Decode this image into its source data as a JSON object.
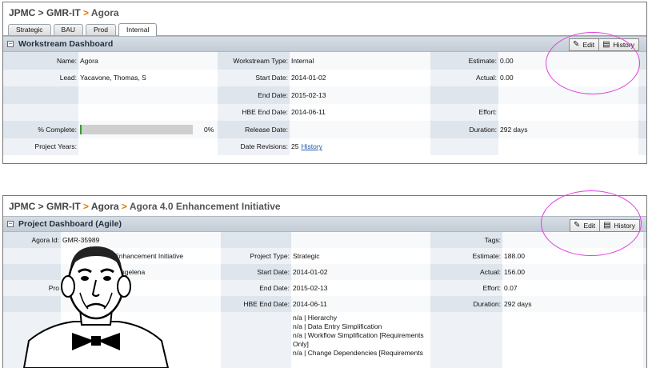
{
  "panel1": {
    "breadcrumb": {
      "a": "JPMC",
      "sep1": " > ",
      "b": "GMR-IT",
      "sep2": " > ",
      "c": "Agora"
    },
    "tabs": [
      "Strategic",
      "BAU",
      "Prod",
      "Internal"
    ],
    "header_title": "Workstream Dashboard",
    "edit_label": "Edit",
    "history_label": "History",
    "fields": {
      "name_label": "Name:",
      "name": "Agora",
      "lead_label": "Lead:",
      "lead": "Yacavone, Thomas, S",
      "pct_label": "% Complete:",
      "pct": "0%",
      "years_label": "Project Years:",
      "ws_type_label": "Workstream Type:",
      "ws_type": "Internal",
      "start_label": "Start Date:",
      "start": "2014-01-02",
      "end_label": "End Date:",
      "end": "2015-02-13",
      "hbe_label": "HBE End Date:",
      "hbe": "2014-06-11",
      "release_label": "Release Date:",
      "revisions_label": "Date Revisions:",
      "revisions": "25",
      "revisions_link": "History",
      "estimate_label": "Estimate:",
      "estimate": "0.00",
      "actual_label": "Actual:",
      "actual": "0.00",
      "effort_label": "Effort:",
      "duration_label": "Duration:",
      "duration": "292 days"
    },
    "progress_fraction": 0.0
  },
  "panel2": {
    "breadcrumb": {
      "a": "JPMC",
      "sep1": " > ",
      "b": "GMR-IT",
      "sep2": " > ",
      "c": "Agora",
      "sep3": " > ",
      "d": "Agora 4.0 Enhancement Initiative"
    },
    "header_title": "Project Dashboard (Agile)",
    "edit_label": "Edit",
    "history_label": "History",
    "fields": {
      "agora_id_label": "Agora Id:",
      "agora_id": "GMR-35989",
      "name_partial": "0 Enhancement Initiative",
      "lead_partial": "ngelena",
      "pro_partial": "Pro",
      "project_type_label": "Project Type:",
      "project_type": "Strategic",
      "start_label": "Start Date:",
      "start": "2014-01-02",
      "end_label": "End Date:",
      "end": "2015-02-13",
      "hbe_label": "HBE End Date:",
      "hbe": "2014-06-11",
      "tags_label": "Tags:",
      "estimate_label": "Estimate:",
      "estimate": "188.00",
      "actual_label": "Actual:",
      "actual": "156.00",
      "effort_label": "Effort:",
      "effort": "0.07",
      "duration_label": "Duration:",
      "duration": "292 days",
      "simplification_items": [
        "n/a | Hierarchy",
        "n/a | Data Entry Simplification",
        "n/a | Workflow Simplification [Requirements",
        "Only]",
        "n/a | Change Dependencies [Requirements"
      ]
    }
  },
  "colors": {
    "highlight_circle": "#e040e0",
    "breadcrumb_sep": "#e07a00",
    "link": "#1c57b0",
    "progress_mark": "#2f9e2f"
  }
}
